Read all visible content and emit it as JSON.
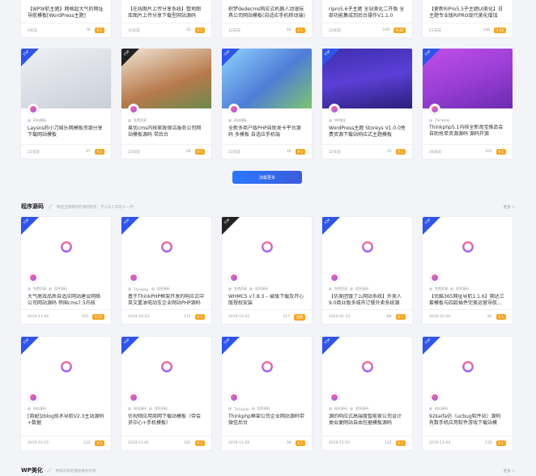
{
  "row_top": [
    {
      "title": "【WP导航主题】网格超大气的网址导航模板[WordPress主题]",
      "date": "9天前",
      "views": "76",
      "price": "¥ 1"
    },
    {
      "title": "【在线图片上传分享系统】整地图库图片上传分享下载型网站源码",
      "date": "10天前",
      "views": "35",
      "price": "¥ 1"
    },
    {
      "title": "织梦dedecms响应式机器人动漫玩具公司网站模板(自适应手机移动端)",
      "date": "10天前",
      "views": "16",
      "price": "¥ 1"
    },
    {
      "title": "ripro5.6子主题 全站美化二开版 全部功能集成到后台操作V1.1.0",
      "date": "20天前",
      "views": "249",
      "price": "¥ 40"
    },
    {
      "title": "【更新RiPro5.5子主题UI美化】日主题专业版RIPRO现代美化增加",
      "date": "21天前",
      "views": "146",
      "price": "¥ 40"
    }
  ],
  "row_thumbs": [
    {
      "title": "Laysns的小刀娱乐网模板资源分享下载网站模板",
      "cat": "网站模板",
      "date": "22天前",
      "views": "37",
      "price": "¥ 1",
      "ribbon": "blue",
      "thumb": "#d8dbe2"
    },
    {
      "title": "易优cms内核家政保洁服务公司网站模板源码 带后台",
      "cat": "免费资源",
      "date": "22天前",
      "views": "26",
      "price": "¥ 1",
      "ribbon": "black",
      "thumb": "#b7794a"
    },
    {
      "title": "全新多商户版PHP自助发卡平台源码 多模板 自适应手机端",
      "cat": "网站模板",
      "date": "22天前",
      "views": "36",
      "price": "¥ 1",
      "ribbon": "blue",
      "thumb": "#4f7dd6"
    },
    {
      "title": "WordPress主题 Storeys V1.0.0免费资源下载站响应式主题模板",
      "cat": "WP美化",
      "date": "22天前",
      "views": "35",
      "price": "¥ 1",
      "ribbon": "blue",
      "thumb": "#3f2fae"
    },
    {
      "title": "Thinkphp5.1内核全新淘宝推品会自助抢单资源源码 源码开源",
      "cat": "Thinkphp",
      "date": "28天前",
      "views": "101",
      "price": "¥ 1",
      "ribbon": "blue",
      "thumb": "#9b3fd6"
    }
  ],
  "load_more": "加载更多",
  "section1": {
    "title": "程序源码",
    "sub": "精选全网最新的源码程序，学习与工作的人一步!",
    "more": "更多 >"
  },
  "row_s1a": [
    {
      "cat": "免费资源",
      "cat2": "程序源码",
      "title": "大气高效品质自适应网站建设网络公司网站源码 帝国cms7.5内核",
      "date": "2019-11-06",
      "views": "105",
      "price": "¥ 15",
      "ribbon": "blue"
    },
    {
      "cat": "Thinkphp",
      "cat2": "程序源码",
      "title": "基于ThinkPHP框架开发的响应式中英文重油电动车企业网站PHP源码",
      "date": "2019-10-23",
      "views": "172",
      "price": "¥ 1",
      "ribbon": "blue"
    },
    {
      "cat": "免费资源",
      "cat2": "程序源码",
      "title": "WHMCS v7.8.3 – 破版下载及开心版授权安装",
      "date": "2019-12-02",
      "views": "217",
      "price": "免费",
      "ribbon": "black"
    },
    {
      "cat": "免费资源",
      "cat2": "程序源码",
      "title": "【仿美团饿了么网站系统】外卖人9.0商业版多城市订餐外卖系统源码…",
      "date": "2020-01-14",
      "views": "88",
      "price": "¥ 1",
      "ribbon": "blue"
    },
    {
      "cat": "免费资源",
      "cat2": "程序源码",
      "title": "【优酷365网址导航1.1.6】期达三套模板与四款插件完美运营导航…",
      "date": "2019-10-29",
      "views": "92",
      "price": "¥ 1",
      "ribbon": "blue"
    }
  ],
  "row_s1b": [
    {
      "cat": "网站源码",
      "title": "[商配]zblog技术导航V2.3主站源码+数据",
      "date": "2019-10-15",
      "views": "133",
      "price": "¥ 1",
      "ribbon": "blue"
    },
    {
      "cat": "网站源码",
      "cat2": "程序源码",
      "title": "仿视频应用商网下载站模板（带会员中心+手机模板）",
      "date": "2019-11-01",
      "views": "181",
      "price": "¥ 1",
      "ribbon": "blue"
    },
    {
      "cat": "Thinkphp",
      "cat2": "程序源码",
      "title": "Thinkphp框架公司企业网站源码带微信后台",
      "date": "2019-11-28",
      "views": "39",
      "price": "¥ 1",
      "ribbon": "blue"
    },
    {
      "cat": "网站源码",
      "cat2": "程序源码",
      "title": "源的响应式高端度智能家公司设计类似便网站自由包据模板源码",
      "date": "2019-11-03",
      "views": "132",
      "price": "¥ 1",
      "ribbon": "blue"
    },
    {
      "cat": "网站源码",
      "title": "92kaifa仿（ucbug软件站）源码 有数手机应用软件游戏下载站模版…",
      "date": "2019-11-04",
      "views": "135",
      "price": "¥ 1",
      "ribbon": "blue"
    }
  ],
  "section2": {
    "title": "WP美化",
    "sub": "精美优质的模板素材资源",
    "more": "更多 >"
  }
}
